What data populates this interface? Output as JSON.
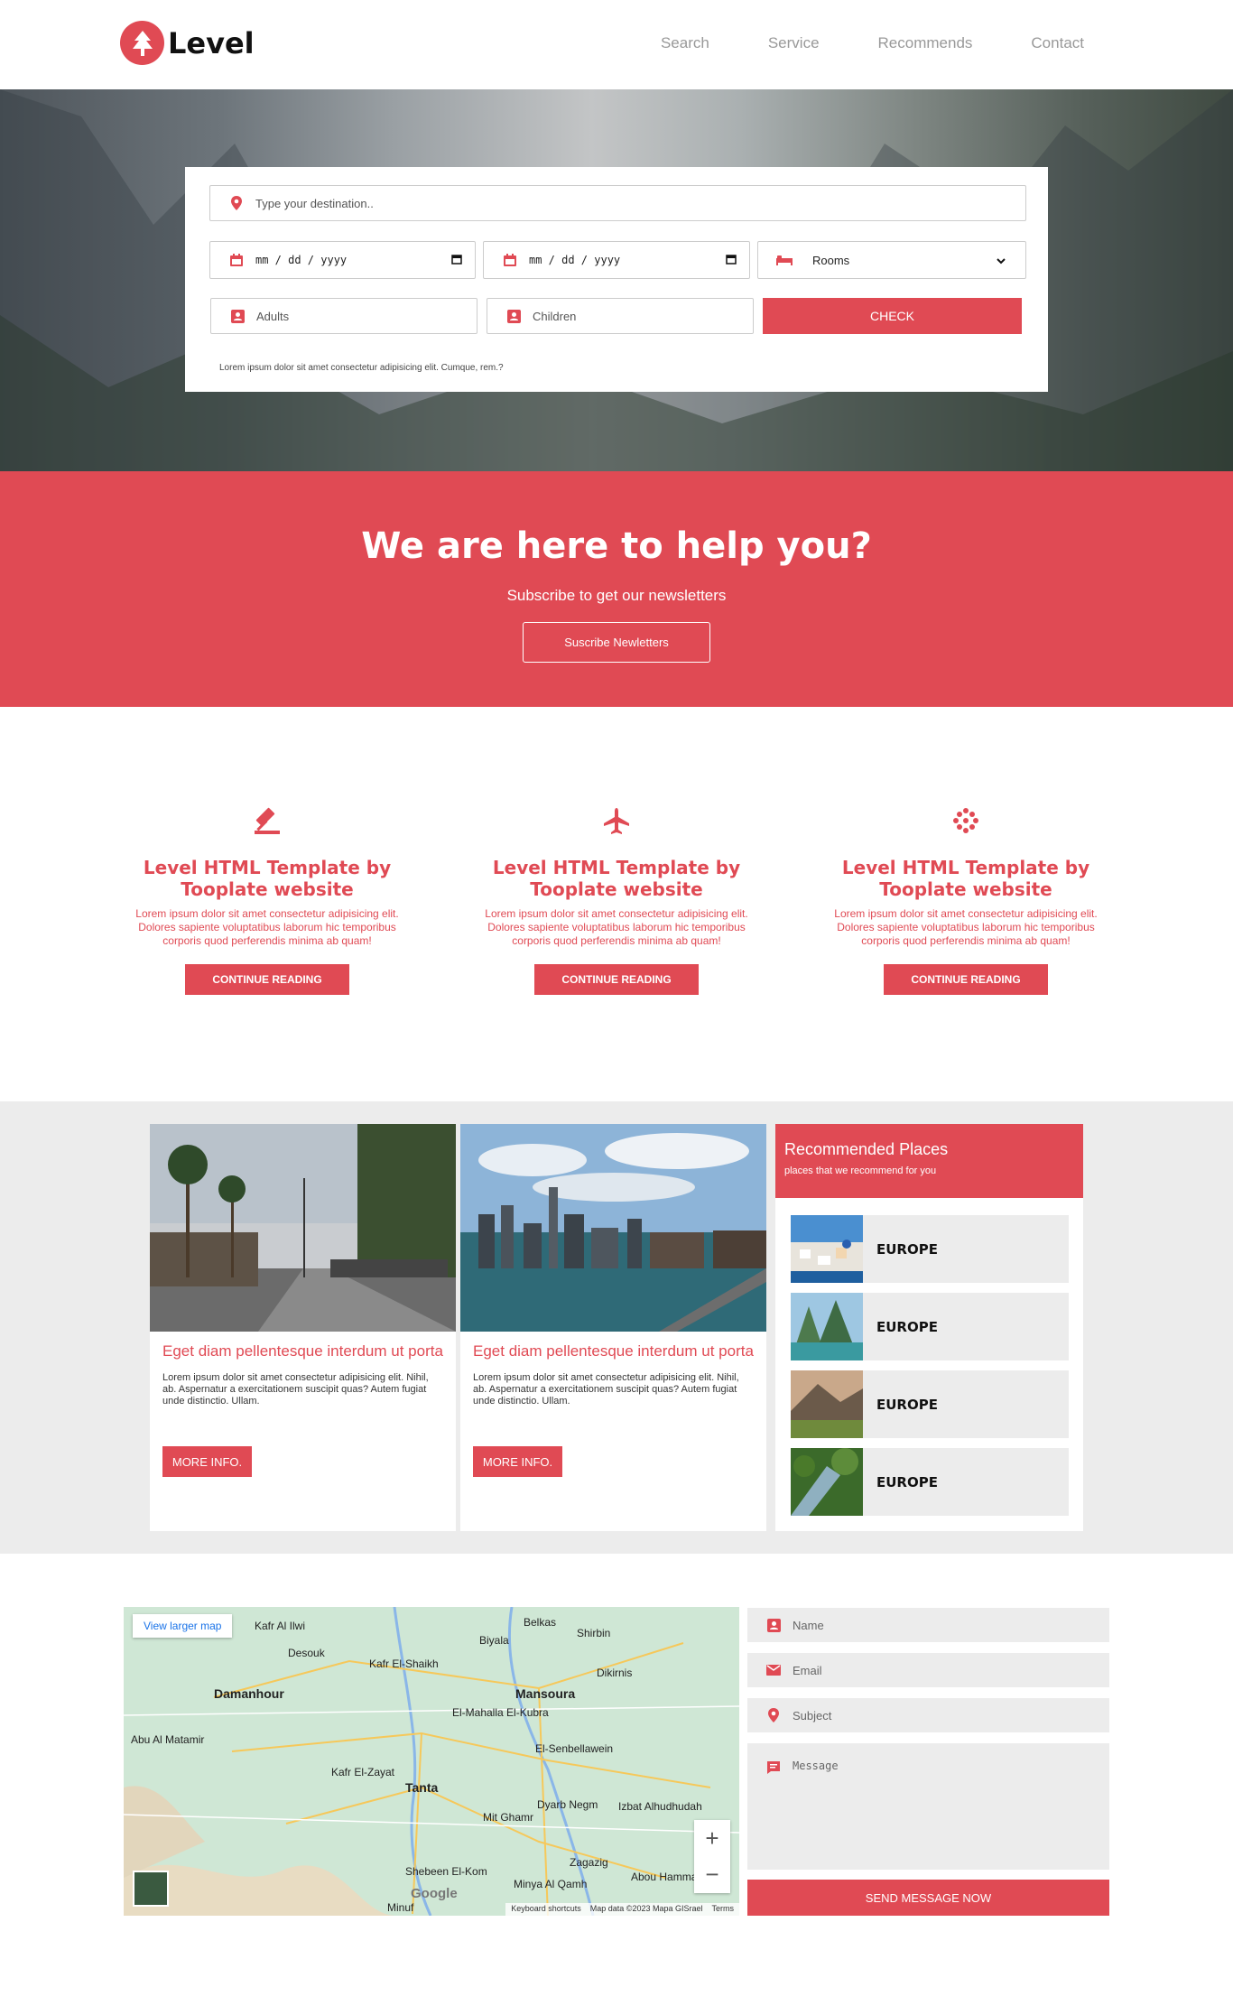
{
  "header": {
    "logo_text": "Level",
    "nav": [
      "Search",
      "Service",
      "Recommends",
      "Contact"
    ]
  },
  "search": {
    "destination_placeholder": "Type your destination..",
    "checkin_value": "mm / dd / yyyy",
    "checkout_value": "mm / dd / yyyy",
    "rooms_selected": "Rooms",
    "adults_placeholder": "Adults",
    "children_placeholder": "Children",
    "check_label": "CHECK",
    "note": "Lorem ipsum dolor sit amet consectetur adipisicing elit. Cumque, rem.?"
  },
  "newsletter": {
    "title": "We are here to help you?",
    "subtitle": "Subscribe to get our newsletters",
    "button": "Suscribe Newletters"
  },
  "features": [
    {
      "icon": "gavel-icon",
      "title": "Level HTML Template by Tooplate website",
      "text": "Lorem ipsum dolor sit amet consectetur adipisicing elit. Dolores sapiente voluptatibus laborum hic temporibus corporis quod perferendis minima ab quam!",
      "button": "CONTINUE READING"
    },
    {
      "icon": "airplane-icon",
      "title": "Level HTML Template by Tooplate website",
      "text": "Lorem ipsum dolor sit amet consectetur adipisicing elit. Dolores sapiente voluptatibus laborum hic temporibus corporis quod perferendis minima ab quam!",
      "button": "CONTINUE READING"
    },
    {
      "icon": "dots-icon",
      "title": "Level HTML Template by Tooplate website",
      "text": "Lorem ipsum dolor sit amet consectetur adipisicing elit. Dolores sapiente voluptatibus laborum hic temporibus corporis quod perferendis minima ab quam!",
      "button": "CONTINUE READING"
    }
  ],
  "cards": [
    {
      "title": "Eget diam pellentesque interdum ut porta",
      "text": "Lorem ipsum dolor sit amet consectetur adipisicing elit. Nihil, ab. Aspernatur a exercitationem suscipit quas? Autem fugiat unde distinctio. Ullam.",
      "button": "MORE INFO."
    },
    {
      "title": "Eget diam pellentesque interdum ut porta",
      "text": "Lorem ipsum dolor sit amet consectetur adipisicing elit. Nihil, ab. Aspernatur a exercitationem suscipit quas? Autem fugiat unde distinctio. Ullam.",
      "button": "MORE INFO."
    }
  ],
  "recommended": {
    "title": "Recommended Places",
    "subtitle": "places that we recommend for you",
    "items": [
      "EUROPE",
      "EUROPE",
      "EUROPE",
      "EUROPE"
    ]
  },
  "map": {
    "view_larger": "View larger map",
    "cities": [
      "Kafr Al Ilwi",
      "Belkas",
      "Shirbin",
      "Desouk",
      "Biyala",
      "Kafr El-Shaikh",
      "Dikirnis",
      "Damanhour",
      "Mansoura",
      "El-Mahalla El-Kubra",
      "Abu Al Matamir",
      "El-Senbellawein",
      "Kafr El-Zayat",
      "Tanta",
      "Dyarb Negm",
      "Mit Ghamr",
      "Izbat Alhudhudah",
      "Zagazig",
      "Shebeen El-Kom",
      "Minya Al Qamh",
      "Abou Hammad",
      "Minuf"
    ],
    "footer": [
      "Keyboard shortcuts",
      "Map data ©2023 Mapa GISrael",
      "Terms"
    ],
    "google": "Google"
  },
  "contact": {
    "name_placeholder": "Name",
    "email_placeholder": "Email",
    "subject_placeholder": "Subject",
    "message_placeholder": "Message",
    "send_label": "SEND MESSAGE NOW"
  },
  "colors": {
    "accent": "#e04a54",
    "gray_bg": "#ececec"
  }
}
